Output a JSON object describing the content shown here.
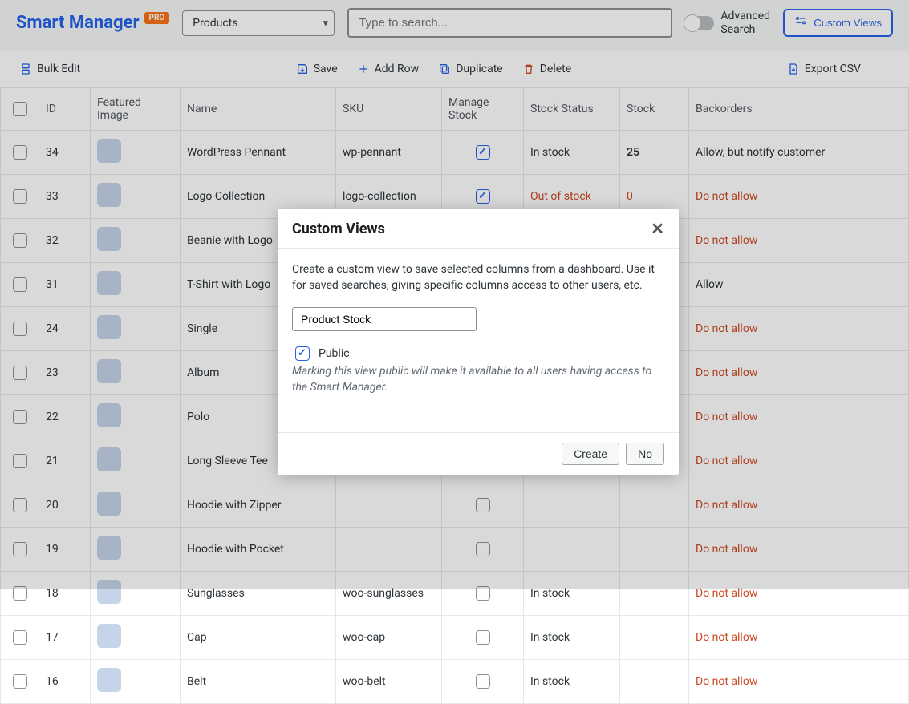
{
  "brand": {
    "name": "Smart Manager",
    "badge": "PRO"
  },
  "dashboard_select": {
    "value": "Products"
  },
  "search": {
    "placeholder": "Type to search..."
  },
  "advanced_search_label": "Advanced\nSearch",
  "custom_views_button": "Custom Views",
  "toolbar": {
    "bulk_edit": "Bulk Edit",
    "save": "Save",
    "add_row": "Add Row",
    "duplicate": "Duplicate",
    "delete": "Delete",
    "export_csv": "Export CSV"
  },
  "columns": {
    "id": "ID",
    "featured_image": "Featured Image",
    "name": "Name",
    "sku": "SKU",
    "manage_stock": "Manage Stock",
    "stock_status": "Stock Status",
    "stock": "Stock",
    "backorders": "Backorders"
  },
  "rows": [
    {
      "id": "34",
      "name": "WordPress Pennant",
      "sku": "wp-pennant",
      "manage_stock": true,
      "stock_status": "In stock",
      "stock_status_warn": false,
      "stock": "25",
      "stock_warn": false,
      "backorders": "Allow, but notify customer",
      "bo_warn": false
    },
    {
      "id": "33",
      "name": "Logo Collection",
      "sku": "logo-collection",
      "manage_stock": true,
      "stock_status": "Out of stock",
      "stock_status_warn": true,
      "stock": "0",
      "stock_warn": true,
      "backorders": "Do not allow",
      "bo_warn": true
    },
    {
      "id": "32",
      "name": "Beanie with Logo",
      "sku": "",
      "manage_stock": false,
      "stock_status": "",
      "stock_status_warn": false,
      "stock": "",
      "stock_warn": false,
      "backorders": "Do not allow",
      "bo_warn": true
    },
    {
      "id": "31",
      "name": "T-Shirt with Logo",
      "sku": "",
      "manage_stock": false,
      "stock_status": "",
      "stock_status_warn": false,
      "stock": "",
      "stock_warn": false,
      "backorders": "Allow",
      "bo_warn": false
    },
    {
      "id": "24",
      "name": "Single",
      "sku": "",
      "manage_stock": false,
      "stock_status": "",
      "stock_status_warn": false,
      "stock": "",
      "stock_warn": false,
      "backorders": "Do not allow",
      "bo_warn": true
    },
    {
      "id": "23",
      "name": "Album",
      "sku": "",
      "manage_stock": false,
      "stock_status": "",
      "stock_status_warn": false,
      "stock": "",
      "stock_warn": false,
      "backorders": "Do not allow",
      "bo_warn": true
    },
    {
      "id": "22",
      "name": "Polo",
      "sku": "",
      "manage_stock": false,
      "stock_status": "",
      "stock_status_warn": false,
      "stock": "",
      "stock_warn": false,
      "backorders": "Do not allow",
      "bo_warn": true
    },
    {
      "id": "21",
      "name": "Long Sleeve Tee",
      "sku": "",
      "manage_stock": false,
      "stock_status": "",
      "stock_status_warn": false,
      "stock": "",
      "stock_warn": false,
      "backorders": "Do not allow",
      "bo_warn": true
    },
    {
      "id": "20",
      "name": "Hoodie with Zipper",
      "sku": "",
      "manage_stock": false,
      "stock_status": "",
      "stock_status_warn": false,
      "stock": "",
      "stock_warn": false,
      "backorders": "Do not allow",
      "bo_warn": true
    },
    {
      "id": "19",
      "name": "Hoodie with Pocket",
      "sku": "",
      "manage_stock": false,
      "stock_status": "",
      "stock_status_warn": false,
      "stock": "",
      "stock_warn": false,
      "backorders": "Do not allow",
      "bo_warn": true
    },
    {
      "id": "18",
      "name": "Sunglasses",
      "sku": "woo-sunglasses",
      "manage_stock": false,
      "stock_status": "In stock",
      "stock_status_warn": false,
      "stock": "",
      "stock_warn": false,
      "backorders": "Do not allow",
      "bo_warn": true
    },
    {
      "id": "17",
      "name": "Cap",
      "sku": "woo-cap",
      "manage_stock": false,
      "stock_status": "In stock",
      "stock_status_warn": false,
      "stock": "",
      "stock_warn": false,
      "backorders": "Do not allow",
      "bo_warn": true
    },
    {
      "id": "16",
      "name": "Belt",
      "sku": "woo-belt",
      "manage_stock": false,
      "stock_status": "In stock",
      "stock_status_warn": false,
      "stock": "",
      "stock_warn": false,
      "backorders": "Do not allow",
      "bo_warn": true
    }
  ],
  "modal": {
    "title": "Custom Views",
    "description": "Create a custom view to save selected columns from a dashboard. Use it for saved searches, giving specific columns access to other users, etc.",
    "name_value": "Product Stock",
    "public_label": "Public",
    "public_checked": true,
    "public_hint": "Marking this view public will make it available to all users having access to the Smart Manager.",
    "create": "Create",
    "no": "No"
  }
}
